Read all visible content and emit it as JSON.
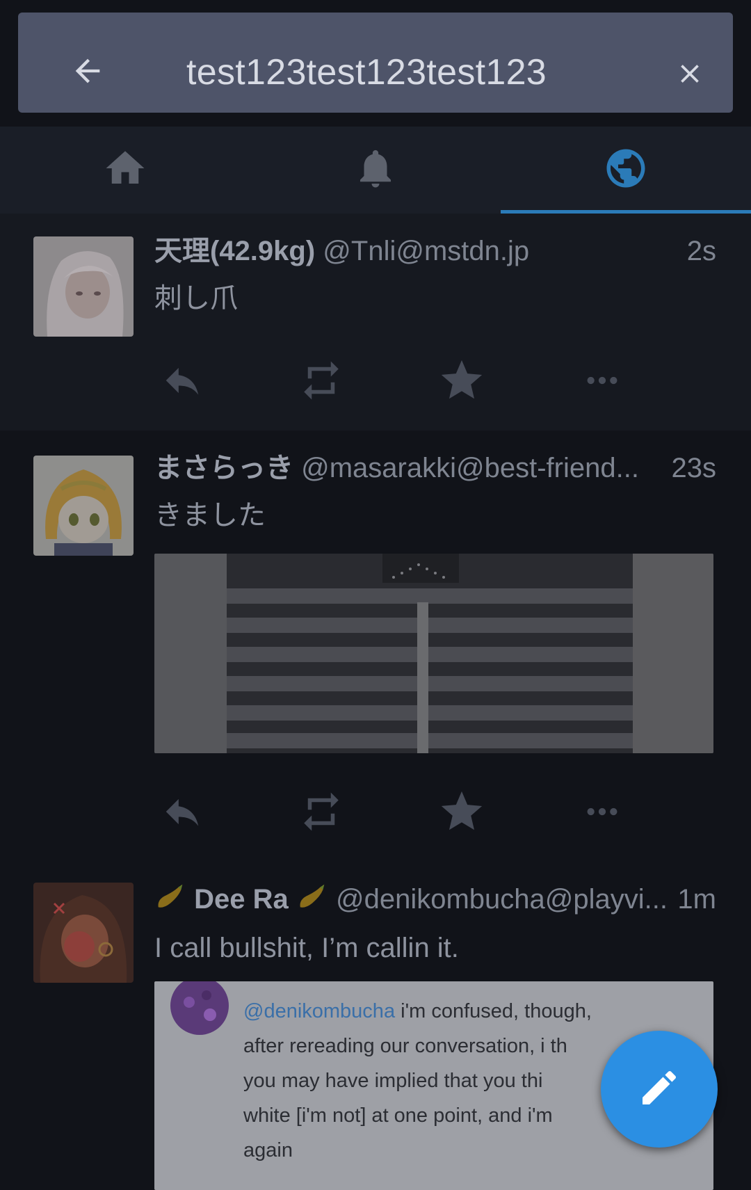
{
  "search": {
    "query": "test123test123test123",
    "back_icon": "arrow-back-icon",
    "clear_icon": "close-icon"
  },
  "tabs": [
    {
      "icon": "home-icon",
      "active": false
    },
    {
      "icon": "bell-icon",
      "active": false
    },
    {
      "icon": "globe-icon",
      "active": true
    }
  ],
  "statuses": [
    {
      "display_name": "天理(42.9kg)",
      "acct": "@Tnli@mstdn.jp",
      "time": "2s",
      "content": "刺し爪"
    },
    {
      "display_name": "まさらっき",
      "acct": "@masarakki@best-friend...",
      "time": "23s",
      "content": "きました"
    },
    {
      "display_name": "Dee Ra",
      "acct": "@denikombucha@playvi...",
      "time": "1m",
      "content": "I call bullshit, I’m callin it.",
      "quote": {
        "mention": "@denikombucha",
        "line1_rest": " i'm confused, though,",
        "line2": "after rereading our conversation, i th",
        "line3": "you may have implied that you thi",
        "line4": "white [i'm not] at one point, and i'm",
        "line5": "again"
      }
    }
  ],
  "actions": [
    "reply-icon",
    "boost-icon",
    "favourite-icon",
    "more-icon"
  ],
  "fab": {
    "icon": "pencil-icon"
  },
  "colors": {
    "background": "#111319",
    "searchbar": "#4e5469",
    "tab_indicator": "#2b7bb8",
    "fab": "#2b8fe3"
  }
}
